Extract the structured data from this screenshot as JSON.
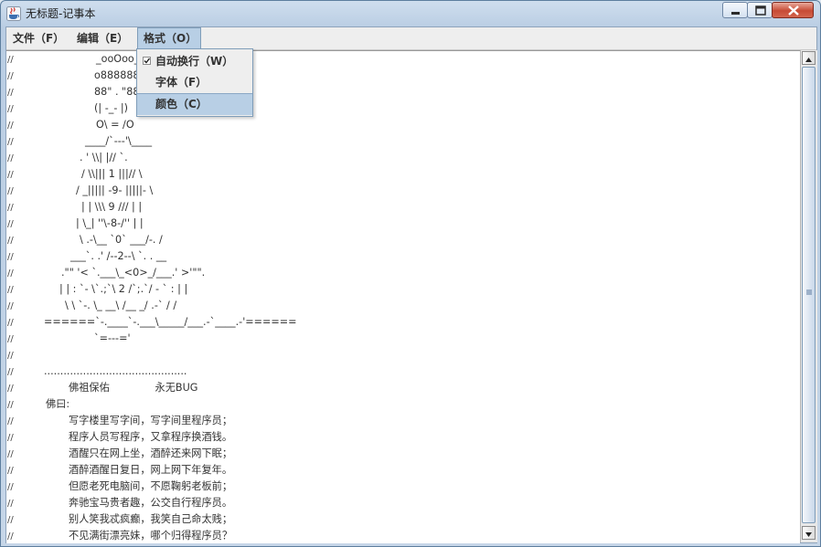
{
  "window": {
    "title": "无标题-记事本"
  },
  "menubar": {
    "file": "文件（F）",
    "edit": "编辑（E）",
    "format": "格式（O）"
  },
  "format_menu": {
    "items": [
      {
        "label": "自动换行（W）",
        "checked": true
      },
      {
        "label": "字体（F）",
        "checked": false
      },
      {
        "label": "颜色（C）",
        "checked": false
      }
    ]
  },
  "editor": {
    "prefix": "//",
    "lines": [
      "_ooOoo_",
      "o8888888o",
      "88\" . \"88",
      "(| -_- |)",
      "O\\ = /O",
      "____/`---'\\____",
      ". ' \\\\| |// `.",
      "/ \\\\||| 1 |||// \\",
      "/ _||||| -9- |||||- \\",
      "| | \\\\\\ 9 /// | |",
      "| \\_| ''\\-8-/'' | |",
      "\\ .-\\__ `0` ___/-. /",
      "___`. .' /--2--\\ `. . __",
      ".\"\" '< `.___\\_<0>_/___.' >'\"\".",
      "| | : `- \\`.;`\\ 2 /`;.`/ - ` : | |",
      "\\ \\ `-. \\_ __\\ /__ _/ .-` / /",
      "======`-.____`-.___\\_____/___.-`____.-'======",
      "`=---='",
      "",
      "............................................",
      "佛祖保佑              永无BUG",
      "佛曰:",
      "写字楼里写字间，写字间里程序员；",
      "程序人员写程序，又拿程序换酒钱。",
      "酒醒只在网上坐，酒醉还来网下眠；",
      "酒醉酒醒日复日，网上网下年复年。",
      "但愿老死电脑间，不愿鞠躬老板前；",
      "奔驰宝马贵者趣，公交自行程序员。",
      "别人笑我忒疯癫，我笑自己命太贱；",
      "不见满街漂亮妹，哪个归得程序员？"
    ]
  },
  "colors": {
    "menu_highlight": "#b8cfe5",
    "editor_bg": "#ffffff"
  },
  "icons": [
    "java-cup-icon",
    "minimize-icon",
    "maximize-icon",
    "close-icon",
    "checkmark-icon",
    "scroll-up-arrow-icon",
    "scroll-down-arrow-icon",
    "scroll-grip-icon"
  ]
}
